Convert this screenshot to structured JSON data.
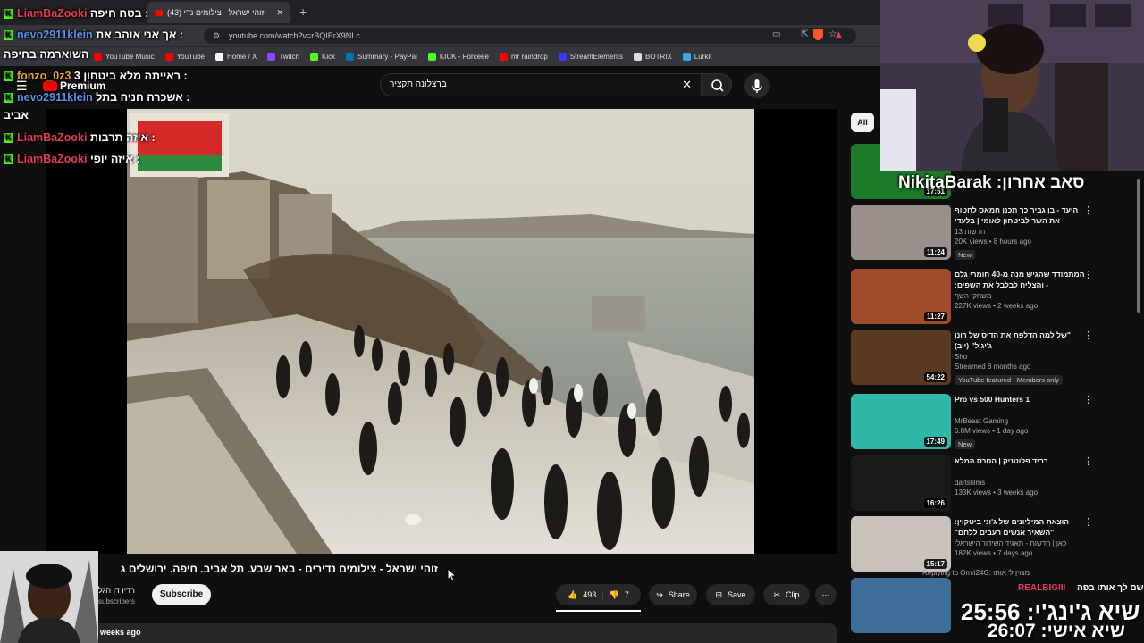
{
  "browser": {
    "active_tab_title": "(43) זוהי ישראל - צילומים נדי",
    "new_tab_symbol": "+",
    "url": "youtube.com/watch?v=rBQIErX9NLc",
    "bookmarks": [
      {
        "label": "YouTube Music",
        "color": "#ff0000"
      },
      {
        "label": "YouTube",
        "color": "#ff0000"
      },
      {
        "label": "Home / X",
        "color": "#ffffff"
      },
      {
        "label": "Twitch",
        "color": "#9146ff"
      },
      {
        "label": "Kick",
        "color": "#53fc18"
      },
      {
        "label": "Summary - PayPal",
        "color": "#0070ba"
      },
      {
        "label": "KICK - Forceee",
        "color": "#53fc18"
      },
      {
        "label": "mr raindrop",
        "color": "#ff0000"
      },
      {
        "label": "StreamElements",
        "color": "#3a3aff"
      },
      {
        "label": "BOTRIX",
        "color": "#dddddd"
      },
      {
        "label": "Lurkit",
        "color": "#3ca5e8"
      }
    ]
  },
  "youtube": {
    "logo": "Premium",
    "search_query": "ברצלונה תקציר",
    "video_title": "זוהי ישראל - צילומים נדירים - באר שבע. תל אביב. חיפה. ירושלים ג",
    "channel_name": "רדיו דן הגל",
    "subscribers": "subscribers",
    "subscribe_label": "Subscribe",
    "likes": "493",
    "dislikes": "7",
    "share_label": "Share",
    "save_label": "Save",
    "clip_label": "Clip",
    "upload_age": "weeks ago",
    "filter_chip": "All"
  },
  "recommendations": [
    {
      "title": "",
      "channel": "",
      "meta": "",
      "badge": "",
      "duration": "17:51",
      "thumb": "#1c7a2a"
    },
    {
      "title": "היעד - בן גביר כך תכנן חמאס לחטוף את השר לביטחון לאומי | בלעדי",
      "channel": "חדשות 13",
      "meta": "20K views • 8 hours ago",
      "badge": "New",
      "duration": "11:24",
      "thumb": "#9a8f8a"
    },
    {
      "title": "המתמודד שהגיש מנה מ-40 חומרי גלם - והצליח לבלבל את השפים:",
      "channel": "משחקי השף",
      "meta": "227K views • 2 weeks ago",
      "badge": "",
      "duration": "11:27",
      "thumb": "#a04b2a"
    },
    {
      "title": "\"של למה הדלפת את הדיס של רונן ג'יג'ל\" (ייב)",
      "channel": "Sho",
      "meta": "Streamed 8 months ago",
      "badge": "YouTube featured · Members only",
      "duration": "54:22",
      "thumb": "#5a3a22"
    },
    {
      "title": "1 Pro vs 500 Hunters",
      "channel": "MrBeast Gaming",
      "meta": "6.8M views • 1 day ago",
      "badge": "New",
      "duration": "17:49",
      "thumb": "#2fb8a8"
    },
    {
      "title": "רביד פלוטניק | הטרס המלא",
      "channel": "dartsfilms",
      "meta": "133K views • 3 weeks ago",
      "badge": "",
      "duration": "16:26",
      "thumb": "#1a1a1a"
    },
    {
      "title": "הוצאת המיליונים של ג'וני ביטקוין: \"השאיר אנשים רעבים ללחם\"",
      "channel": "כאן | חדשות - תאגיד השידור הישראלי",
      "meta": "182K views • 7 days ago",
      "badge": "",
      "duration": "15:17",
      "thumb": "#c9c2b8"
    }
  ],
  "chat": [
    {
      "user": "LiamBaZooki",
      "text": "בטח חיפה :",
      "color": "red"
    },
    {
      "user": "nevo2911klein",
      "text": "אך אני אוהב את :",
      "color": "blue"
    },
    {
      "user": "",
      "text": "השוארמה בחיפה",
      "color": ""
    },
    {
      "user": "fonzo_0z3",
      "text": "ראייתה מלא ביטחון 3 :",
      "color": "orange"
    },
    {
      "user": "nevo2911klein",
      "text": "אשכרה חניה בתל :",
      "color": "blue"
    },
    {
      "user": "",
      "text": "אביב",
      "color": ""
    },
    {
      "user": "LiamBaZooki",
      "text": "איזה תרבות :",
      "color": "red"
    },
    {
      "user": "LiamBaZooki",
      "text": "איזה יופי :",
      "color": "red"
    }
  ],
  "stream_overlay": {
    "last_sub_alert": "סאב אחרון: NikitaBarak",
    "reply_note": "Replying to Omri24G: מצוין ל' אותו",
    "bottom_user": "REALBIGIII",
    "bottom_msg": "שם לך אותו בפה",
    "timer_main": "שיא ג'ינג'י: 25:56",
    "timer_personal": "שיא אישי: 26:07"
  }
}
